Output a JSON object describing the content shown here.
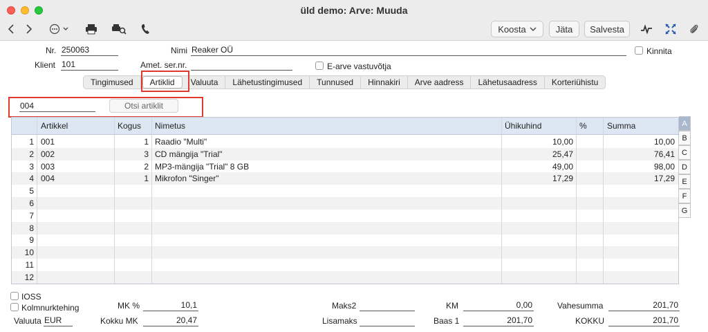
{
  "window": {
    "title": "üld demo: Arve: Muuda"
  },
  "toolbar": {
    "koosta": "Koosta",
    "jata": "Jäta",
    "salvesta": "Salvesta"
  },
  "form": {
    "nr_label": "Nr.",
    "nr_value": "250063",
    "nimi_label": "Nimi",
    "nimi_value": "Reaker OÜ",
    "kinnita_label": "Kinnita",
    "klient_label": "Klient",
    "klient_value": "101",
    "amet_label": "Amet. ser.nr.",
    "amet_value": "",
    "earve_label": "E-arve vastuvõtja"
  },
  "tabs": [
    "Tingimused",
    "Artiklid",
    "Valuuta",
    "Lähetustingimused",
    "Tunnused",
    "Hinnakiri",
    "Arve aadress",
    "Lähetusaadress",
    "Korteriühistu"
  ],
  "search": {
    "value": "004",
    "button": "Otsi artiklit"
  },
  "grid": {
    "headers": {
      "artikkel": "Artikkel",
      "kogus": "Kogus",
      "nimetus": "Nimetus",
      "uhikuhind": "Ühikuhind",
      "pct": "%",
      "summa": "Summa"
    },
    "rows": [
      {
        "n": "1",
        "artikkel": "001",
        "kogus": "1",
        "nimetus": "Raadio \"Multi\"",
        "uhikuhind": "10,00",
        "pct": "",
        "summa": "10,00"
      },
      {
        "n": "2",
        "artikkel": "002",
        "kogus": "3",
        "nimetus": "CD mängija \"Trial\"",
        "uhikuhind": "25,47",
        "pct": "",
        "summa": "76,41"
      },
      {
        "n": "3",
        "artikkel": "003",
        "kogus": "2",
        "nimetus": "MP3-mängija \"Trial\" 8 GB",
        "uhikuhind": "49,00",
        "pct": "",
        "summa": "98,00"
      },
      {
        "n": "4",
        "artikkel": "004",
        "kogus": "1",
        "nimetus": "Mikrofon \"Singer\"",
        "uhikuhind": "17,29",
        "pct": "",
        "summa": "17,29"
      },
      {
        "n": "5"
      },
      {
        "n": "6"
      },
      {
        "n": "7"
      },
      {
        "n": "8"
      },
      {
        "n": "9"
      },
      {
        "n": "10"
      },
      {
        "n": "11"
      },
      {
        "n": "12"
      }
    ]
  },
  "sidetabs": [
    "A",
    "B",
    "C",
    "D",
    "E",
    "F",
    "G"
  ],
  "footer": {
    "ioss": "IOSS",
    "kolmnurk": "Kolmnurktehing",
    "valuuta_label": "Valuuta",
    "valuuta_value": "EUR",
    "mk_label": "MK %",
    "mk_value": "10,1",
    "kokkumk_label": "Kokku MK",
    "kokkumk_value": "20,47",
    "maks2_label": "Maks2",
    "maks2_value": "",
    "lisamaks_label": "Lisamaks",
    "lisamaks_value": "",
    "km_label": "KM",
    "km_value": "0,00",
    "baas_label": "Baas 1",
    "baas_value": "201,70",
    "vahesumma_label": "Vahesumma",
    "vahesumma_value": "201,70",
    "kokku_label": "KOKKU",
    "kokku_value": "201,70"
  }
}
